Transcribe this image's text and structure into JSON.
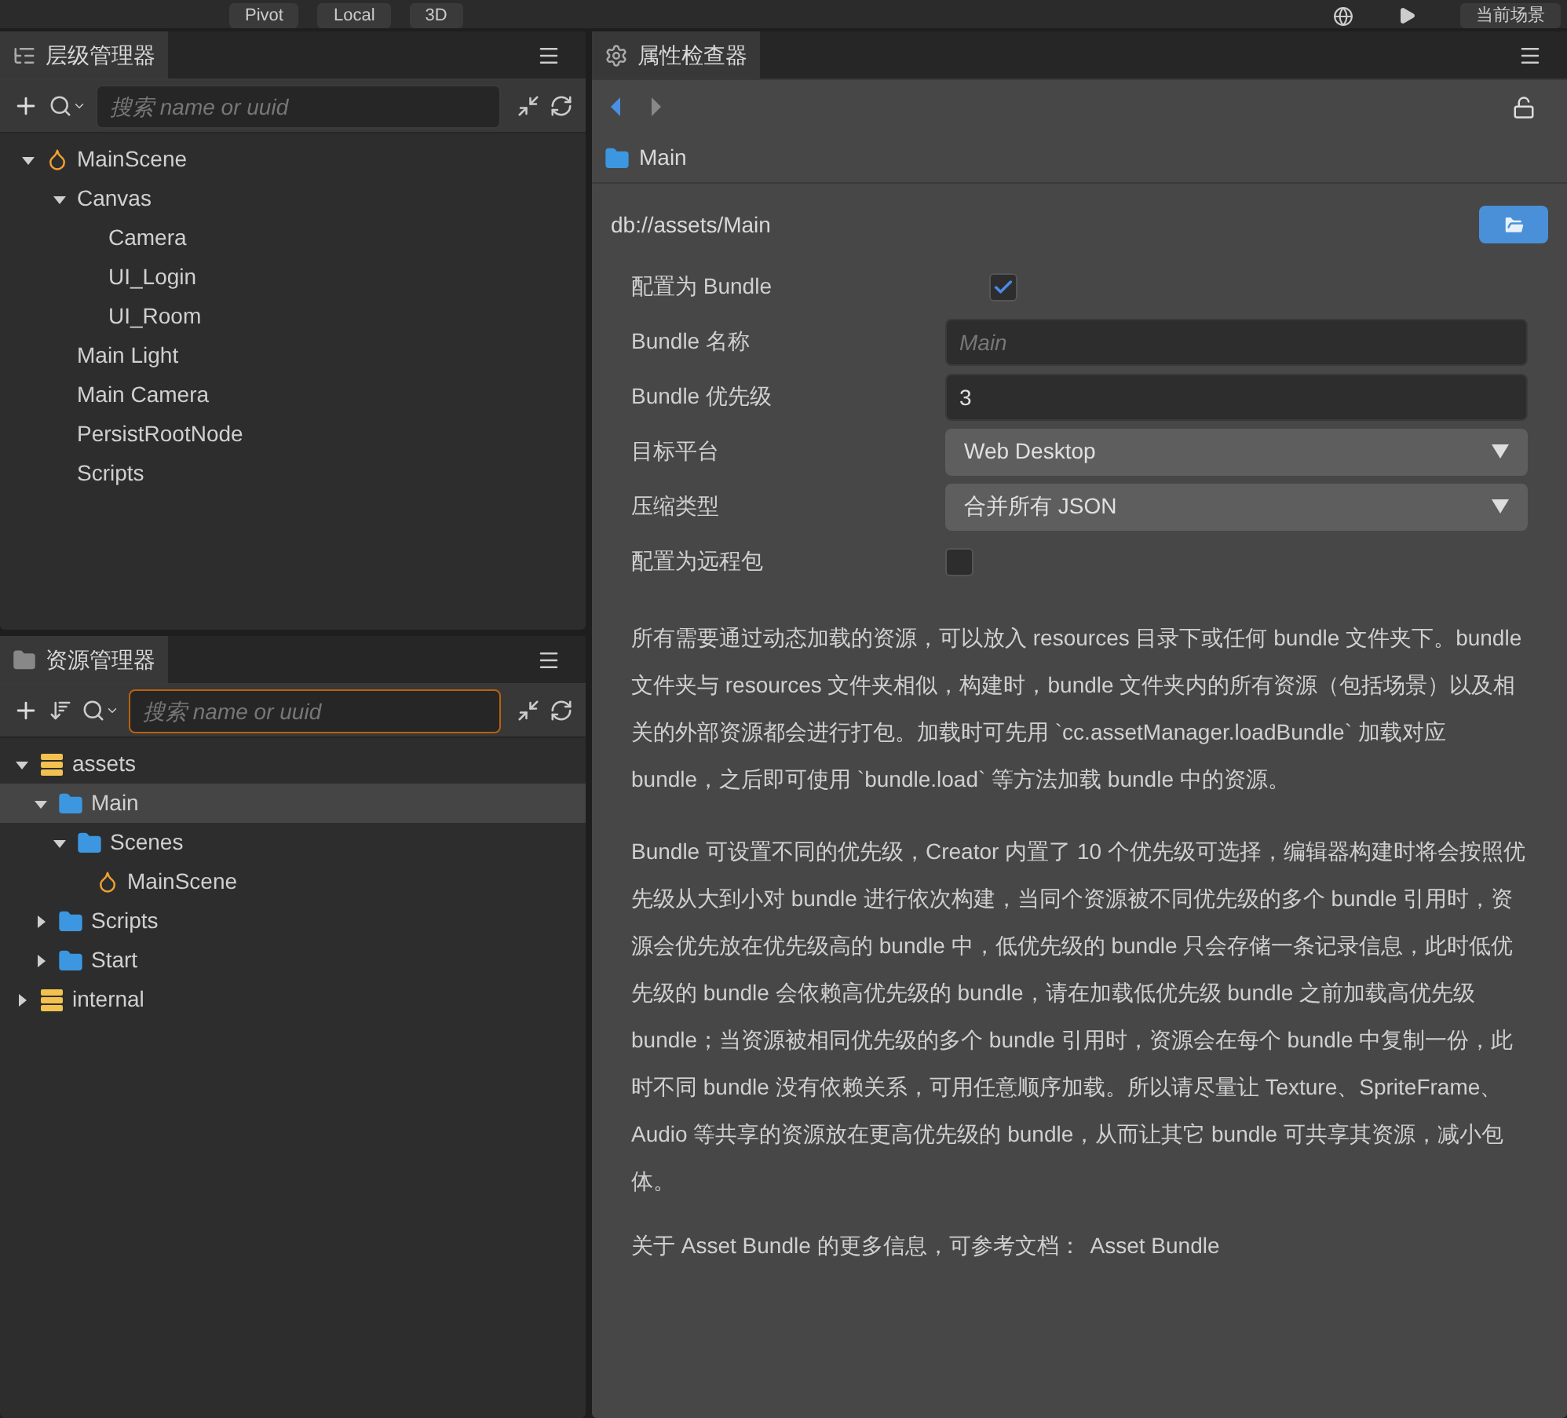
{
  "toolbar": {
    "buttons": [
      {
        "label": "Pivot"
      },
      {
        "label": "Local"
      },
      {
        "label": "3D"
      }
    ],
    "scene_button": "当前场景"
  },
  "hierarchy": {
    "tab": "层级管理器",
    "search": {
      "placeholder": "搜索 name or uuid"
    },
    "tree": [
      {
        "label": "MainScene",
        "kind": "scene",
        "expanded": true,
        "children": [
          {
            "label": "Canvas",
            "kind": "node",
            "expanded": true,
            "children": [
              {
                "label": "Camera",
                "kind": "node"
              },
              {
                "label": "UI_Login",
                "kind": "node"
              },
              {
                "label": "UI_Room",
                "kind": "node"
              }
            ]
          },
          {
            "label": "Main Light",
            "kind": "node"
          },
          {
            "label": "Main Camera",
            "kind": "node"
          },
          {
            "label": "PersistRootNode",
            "kind": "node"
          },
          {
            "label": "Scripts",
            "kind": "node"
          }
        ]
      }
    ]
  },
  "assets": {
    "tab": "资源管理器",
    "search": {
      "placeholder": "搜索 name or uuid"
    },
    "tree": [
      {
        "label": "assets",
        "kind": "db",
        "expanded": true,
        "selected": false,
        "children": [
          {
            "label": "Main",
            "kind": "folder",
            "expanded": true,
            "selected": true,
            "children": [
              {
                "label": "Scenes",
                "kind": "folder",
                "expanded": true,
                "selected": false,
                "children": [
                  {
                    "label": "MainScene",
                    "kind": "scene",
                    "selected": false
                  }
                ]
              }
            ]
          },
          {
            "label": "Scripts",
            "kind": "folder",
            "expanded": false,
            "selected": false
          },
          {
            "label": "Start",
            "kind": "folder",
            "expanded": false,
            "selected": false
          }
        ]
      },
      {
        "label": "internal",
        "kind": "db",
        "expanded": false,
        "selected": false
      }
    ]
  },
  "inspector": {
    "tab": "属性检查器",
    "breadcrumb": "Main",
    "path": "db://assets/Main",
    "fields": [
      {
        "label": "配置为 Bundle",
        "kind": "checkbox",
        "checked": true
      },
      {
        "label": "Bundle 名称",
        "kind": "input",
        "placeholder": "Main"
      },
      {
        "label": "Bundle 优先级",
        "kind": "input",
        "value": "3"
      },
      {
        "label": "目标平台",
        "kind": "select",
        "value": "Web Desktop"
      },
      {
        "label": "压缩类型",
        "kind": "select",
        "value": "合并所有 JSON"
      },
      {
        "label": "配置为远程包",
        "kind": "checkbox",
        "checked": false
      }
    ],
    "paragraphs": [
      "所有需要通过动态加载的资源，可以放入 resources 目录下或任何 bundle 文件夹下。bundle 文件夹与 resources 文件夹相似，构建时，bundle 文件夹内的所有资源（包括场景）以及相关的外部资源都会进行打包。加载时可先用 `cc.assetManager.loadBundle` 加载对应 bundle，之后即可使用 `bundle.load` 等方法加载 bundle 中的资源。",
      "Bundle 可设置不同的优先级，Creator 内置了 10 个优先级可选择，编辑器构建时将会按照优先级从大到小对 bundle 进行依次构建，当同个资源被不同优先级的多个 bundle 引用时，资源会优先放在优先级高的 bundle 中，低优先级的 bundle 只会存储一条记录信息，此时低优先级的 bundle 会依赖高优先级的 bundle，请在加载低优先级 bundle 之前加载高优先级 bundle；当资源被相同优先级的多个 bundle 引用时，资源会在每个 bundle 中复制一份，此时不同 bundle 没有依赖关系，可用任意顺序加载。所以请尽量让 Texture、SpriteFrame、Audio 等共享的资源放在更高优先级的 bundle，从而让其它 bundle 可共享其资源，减小包体。"
    ],
    "more_info": {
      "text": "关于 Asset Bundle 的更多信息，可参考文档：",
      "link": "Asset Bundle"
    }
  }
}
